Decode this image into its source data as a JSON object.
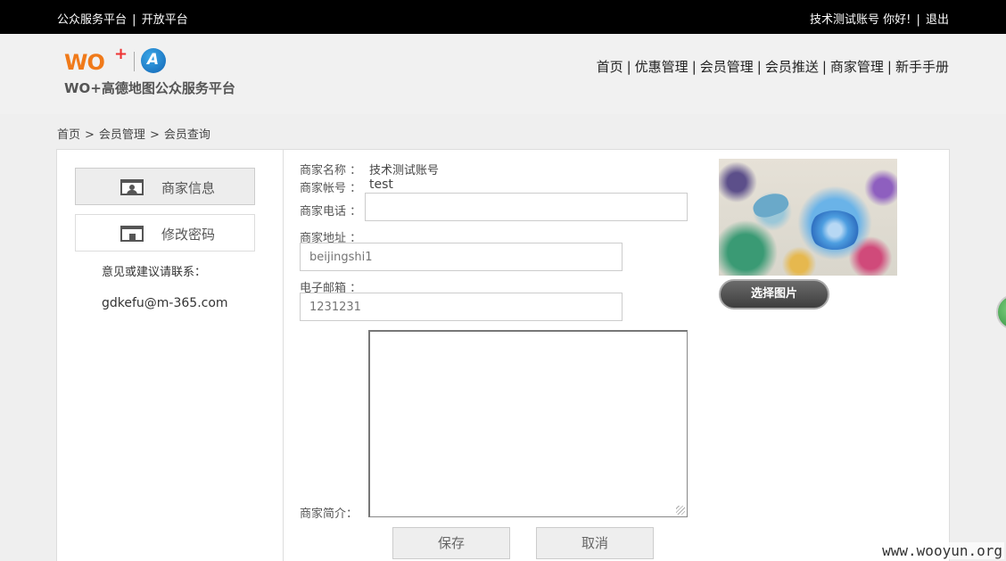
{
  "topbar": {
    "platform_link": "公众服务平台",
    "open_link": "开放平台",
    "separator": "|",
    "greeting": "技术测试账号 你好!",
    "logout": "退出"
  },
  "logo": {
    "wo": "WO",
    "plus": "+",
    "text": "WO+高德地图公众服务平台"
  },
  "nav": {
    "items": [
      "首页",
      "优惠管理",
      "会员管理",
      "会员推送",
      "商家管理",
      "新手手册"
    ],
    "separator": "|"
  },
  "breadcrumb": {
    "items": [
      "首页",
      "会员管理",
      "会员查询"
    ],
    "separator": ">"
  },
  "sidebar": {
    "items": [
      {
        "label": "商家信息",
        "icon": "id-card-icon"
      },
      {
        "label": "修改密码",
        "icon": "lock-icon"
      }
    ],
    "contact_label": "意见或建议请联系：",
    "contact_email": "gdkefu@m-365.com"
  },
  "form": {
    "merchant_name_label": "商家名称 ：",
    "merchant_name_value": "技术测试账号",
    "merchant_account_label": "商家帐号 ：",
    "merchant_account_value": "test",
    "phone_label": "商家电话 ：",
    "phone_value": "",
    "address_label": "商家地址 ：",
    "address_placeholder": "beijingshi1",
    "email_label": "电子邮箱 ：",
    "email_placeholder": "1231231",
    "intro_label": "商家简介：",
    "save_label": "保存",
    "cancel_label": "取消"
  },
  "image": {
    "select_label": "选择图片"
  },
  "watermark": "www.wooyun.org"
}
